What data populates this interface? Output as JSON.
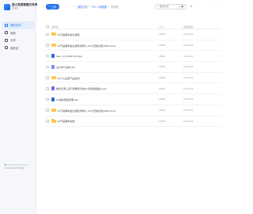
{
  "brand": {
    "name": "百小花的家庭文件夹",
    "sub": "家庭版"
  },
  "sidebar": {
    "items": [
      {
        "label": "我的文件",
        "active": true,
        "icon": "folder-icon"
      },
      {
        "label": "相册",
        "active": false,
        "icon": "photo-icon"
      },
      {
        "label": "分享",
        "active": false,
        "icon": "share-icon"
      },
      {
        "label": "回收站",
        "active": false,
        "icon": "trash-icon"
      }
    ],
    "storage": {
      "text": "52.64GB/2.2TB 容量",
      "fraction": 0.024
    }
  },
  "toolbar": {
    "upload_label": "上传",
    "breadcrumb": [
      "我的文件",
      "7XY 人脸数据",
      "文件夹"
    ],
    "search_placeholder": "搜索文件"
  },
  "table": {
    "headers": {
      "name": "文件名",
      "size": "大小",
      "date": "修改时间"
    },
    "rows": [
      {
        "name": "01产品需求会议通知",
        "type": "folder",
        "size": "10KB",
        "date": "01-03 16"
      },
      {
        "name": "01产品需求会议通知(附件)_XX人员信息表(2016.10.1)",
        "type": "folder",
        "size": "10KB",
        "date": "01-03 16"
      },
      {
        "name": "Kite_UX_2019-10-8.doc",
        "type": "doc",
        "size": "10KB",
        "date": "01-03 16"
      },
      {
        "name": "设计学习资料.zip",
        "type": "zip",
        "size": "10KB",
        "date": "01-03 16"
      },
      {
        "name": "01个人应用产品资料",
        "type": "folder",
        "size": "10KB",
        "date": "01-03 16"
      },
      {
        "name": "模仿记录_演示录屏和分镜4×1周经验图文.mp4",
        "type": "video",
        "size": "10KB",
        "date": "01-03 16"
      },
      {
        "name": "01组织研发手册.doc",
        "type": "doc",
        "size": "10KB",
        "date": "01-03 16"
      },
      {
        "name": "01产品需求会议通知(附件)_XX人员信息表(2016.10.1)",
        "type": "folder",
        "size": "10KB",
        "date": "01-03 16"
      },
      {
        "name": "01产品需求文档",
        "type": "folder",
        "size": "10KB",
        "date": "01-03 16"
      }
    ]
  },
  "colors": {
    "accent": "#2b73f0",
    "folder": "#ffc94b",
    "sidebar_bg": "#f6f7fa"
  }
}
